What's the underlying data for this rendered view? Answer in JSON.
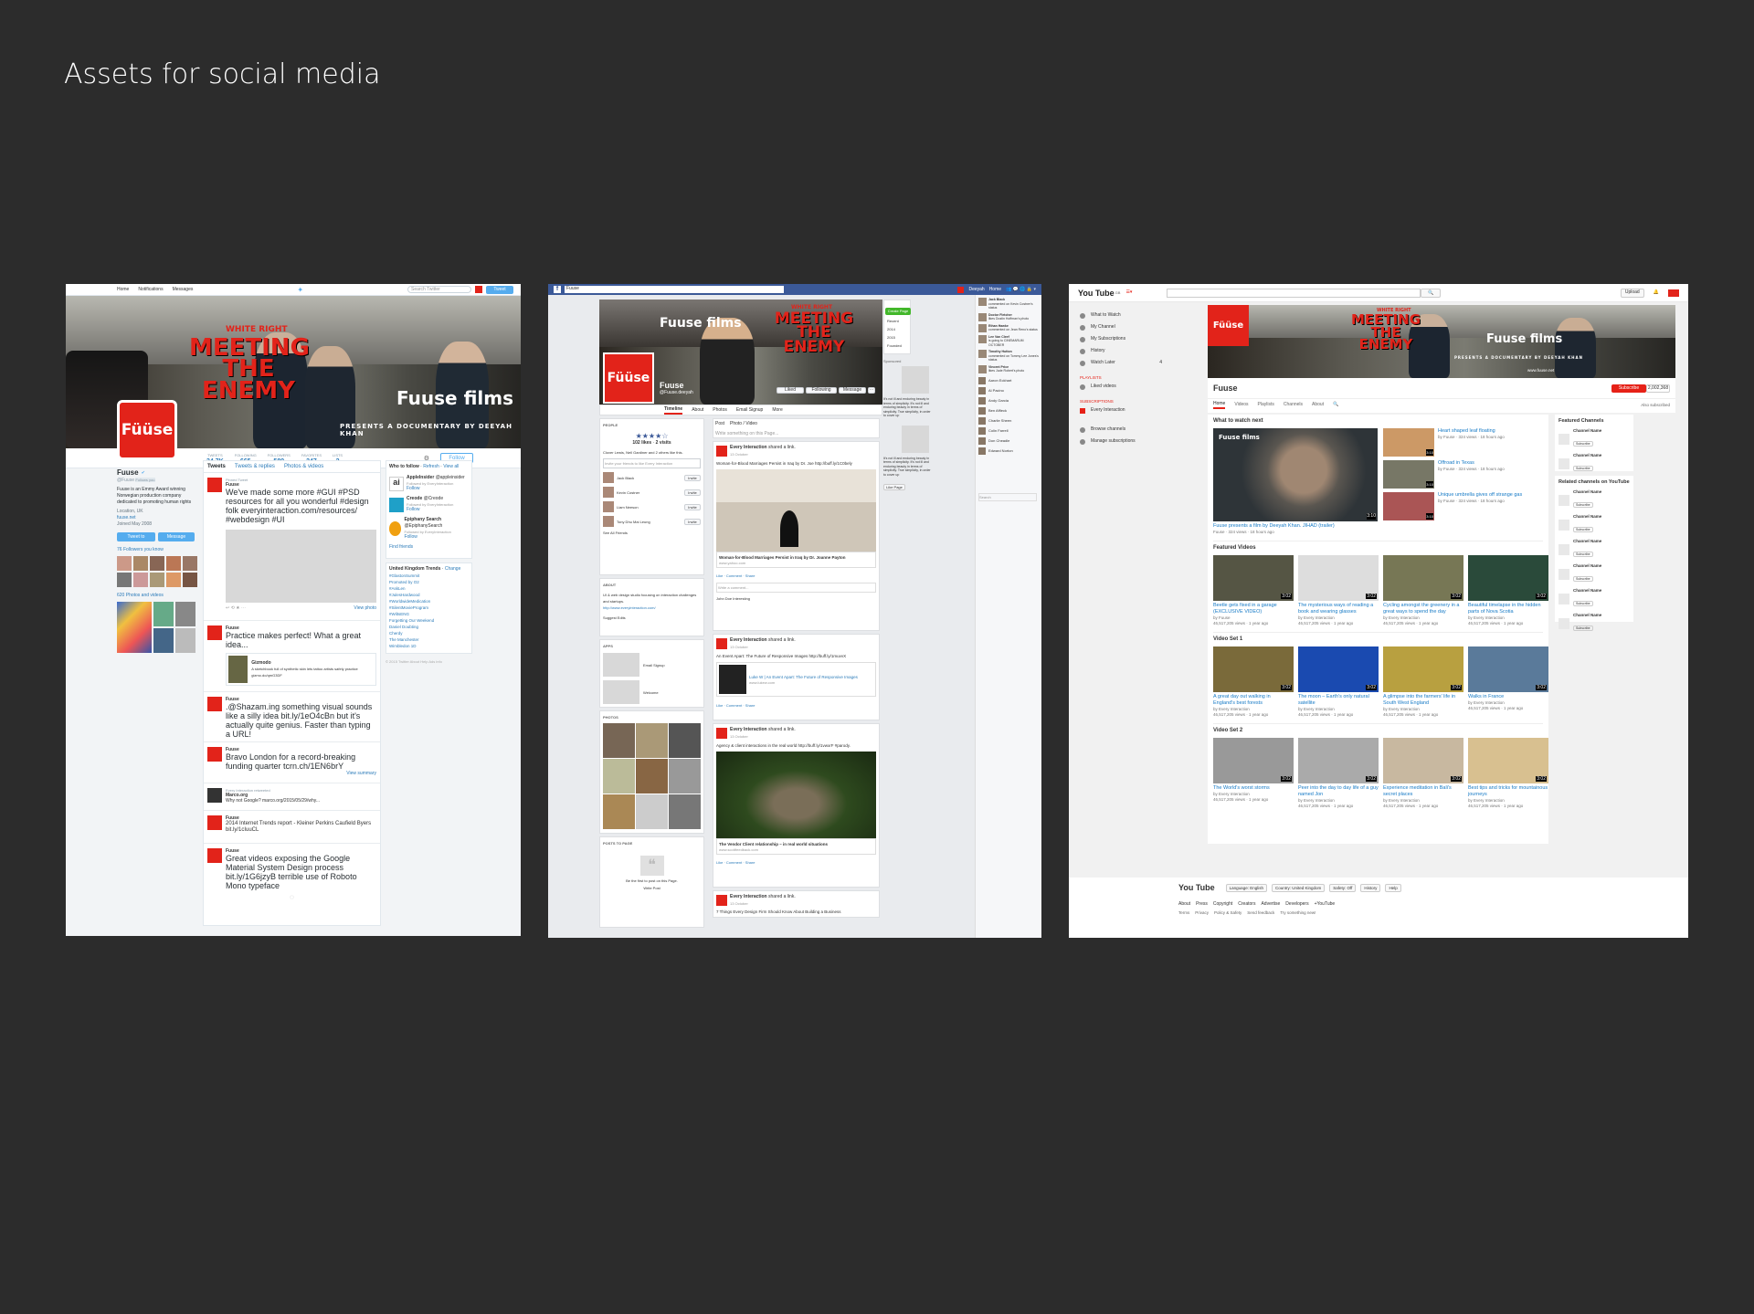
{
  "page": {
    "title": "Assets for social media"
  },
  "twitter": {
    "nav": [
      "Home",
      "Notifications",
      "Messages"
    ],
    "search_placeholder": "Search Twitter",
    "tweet_button": "Tweet",
    "banner": {
      "white_right": "WHITE RIGHT",
      "meeting": "MEETING",
      "the": "THE",
      "enemy": "ENEMY",
      "films": "Fuuse films",
      "present": "PRESENTS A DOCUMENTARY BY DEEYAH KHAN"
    },
    "profile": {
      "name": "Fuuse",
      "handle": "@Fuuse",
      "follows_you": "Follows you",
      "bio": "Fuuse is an Emmy Award winning Norwegian production company dedicated to promoting human rights",
      "location": "Location, UK",
      "url": "fuuse.net",
      "joined": "Joined May 2008",
      "logo": "Füüse"
    },
    "stats": [
      {
        "label": "TWEETS",
        "value": "34.7K"
      },
      {
        "label": "FOLLOWING",
        "value": "665"
      },
      {
        "label": "FOLLOWERS",
        "value": "589"
      },
      {
        "label": "FAVORITES",
        "value": "247"
      },
      {
        "label": "LISTS",
        "value": "2"
      }
    ],
    "follow_label": "Follow",
    "tabs": [
      "Tweets",
      "Tweets & replies",
      "Photos & videos"
    ],
    "tweet_to": "Tweet to",
    "message": "Message",
    "followers_you_know": "76 Followers you know",
    "photos_videos": "620 Photos and videos",
    "view_photo": "View photo",
    "view_summary": "View summary",
    "tweets": [
      {
        "meta": "Pinned Tweet",
        "name": "Fuuse",
        "text": "We've made some more #GUI #PSD resources for all you wonderful #design folk everyinteraction.com/resources/ #webdesign #UI"
      },
      {
        "name": "Fuuse",
        "text": "Practice makes perfect! What a great idea...",
        "quote_name": "Gizmodo",
        "quote": "A sketchbook full of synthetic skin lets tattoo artists safely practice gizmo.do/qmG3DF"
      },
      {
        "name": "Fuuse",
        "text": ".@Shazam.ing something visual sounds like a silly idea bit.ly/1eO4cBn but it's actually quite genius. Faster than typing a URL!"
      },
      {
        "name": "Fuuse",
        "text": "Bravo London for a record-breaking funding quarter tcrn.ch/1EN6brY"
      },
      {
        "meta": "Every Interaction retweeted",
        "name": "Marco.org",
        "text": "Why not Google? marco.org/2015/05/29/why..."
      },
      {
        "name": "Fuuse",
        "text": "2014 Internet Trends report - Kleiner Perkins Caufield Byers bit.ly/1cIuuCL"
      },
      {
        "name": "Fuuse",
        "text": "Great videos exposing the Google Material System Design process bit.ly/1G6jzyB terrible use of Roboto Mono typeface"
      }
    ],
    "who_to_follow": "Who to follow",
    "refresh": "Refresh",
    "view_all": "View all",
    "suggestions": [
      {
        "name": "AppleInsider",
        "handle": "@appleinsider",
        "sub": "Followed by EveryInteraction"
      },
      {
        "name": "Creode",
        "handle": "@Creode",
        "sub": "Followed by EveryInteraction"
      },
      {
        "name": "Epiphany Search",
        "handle": "@EpiphanySearch",
        "sub": "Followed by EveryInteraction"
      }
    ],
    "find_friends": "Find friends",
    "trends_title": "United Kingdom Trends",
    "change": "Change",
    "trends": [
      "#GlastonSummit",
      "Promoted by O2",
      "#AskLen",
      "#JulesHardwood",
      "#WorldwideMedication",
      "#SilentMovieProgram",
      "#WiltsENG",
      "Forgetting Our Weekend",
      "Daniel Doubting",
      "Cherdy",
      "The Manchester",
      "Wimbledon 1D"
    ],
    "footer": "© 2015 Twitter  About  Help  Ads info"
  },
  "facebook": {
    "search": "Fuuse",
    "nav_user": "Deeyah",
    "nav_home": "Home",
    "page_name": "Fuuse",
    "page_handle": "@Fuuse.deeyah",
    "liked": "Liked",
    "following": "Following",
    "message": "Message",
    "create_page": "Create Page",
    "years": [
      "Recent",
      "2014",
      "2015",
      "Founded"
    ],
    "sponsored": "Sponsored",
    "tabs": [
      "Timeline",
      "About",
      "Photos",
      "Email Signup",
      "More"
    ],
    "people": "PEOPLE",
    "likes_count": "102 likes",
    "visits": "2 visits",
    "friends_like": "Clover Lewis, Neil Gardiner and 2 others like this.",
    "invite_placeholder": "Invite your friends to like Every Interaction",
    "invite": "Invite",
    "invite_people": [
      "Jack Black",
      "Kevin Costner",
      "Liam Neeson",
      "Tony Dhu Mai Leung"
    ],
    "see_all_friends": "See All Friends",
    "about": "ABOUT",
    "about_text": "UI & web design studio focusing on interaction challenges and startups.",
    "about_url": "http://www.everyinteraction.com/",
    "suggest_edits": "Suggest Edits",
    "apps": "APPS",
    "apps_list": [
      "Email Signup",
      "Welcome"
    ],
    "photos": "PHOTOS",
    "posts_to_page": "POSTS TO PAGE",
    "first_to_post": "Be the first to post on this Page.",
    "write_post": "Write Post",
    "composer": [
      "Post",
      "Photo / Video"
    ],
    "composer_placeholder": "Write something on this Page...",
    "posts": [
      {
        "name": "Every Interaction",
        "meta": "shared a link.",
        "date": "13 October",
        "text": "Woman-for-Blood Marriages Persist in Iraq by Dr. Joe http://buff.ly/1C0bely",
        "link_title": "Woman-for-Blood Marriages Persist in Iraq by Dr. Joanne Payton",
        "link_domain": "www.yahoo.com"
      },
      {
        "name": "Every Interaction",
        "meta": "shared a link.",
        "date": "13 October",
        "text": "An Event Apart: The Future of Responsive Images http://buff.ly/1muvvX",
        "link_title": "Luke W | An Event Apart: The Future of Responsive Images",
        "link_domain": "www.lukew.com"
      },
      {
        "name": "Every Interaction",
        "meta": "shared a link.",
        "date": "13 October",
        "text": "Agency & client interactions in the real world http://buff.ly/1vwxrF #parody.",
        "link_title": "The Vendor Client relationship – in real world situations",
        "link_domain": "www.scottfeedback.com"
      },
      {
        "name": "Every Interaction",
        "meta": "shared a link.",
        "date": "13 October",
        "text": "7 Things Every Design Firm Should Know About Building a Business"
      }
    ],
    "actions": "Like · Comment · Share",
    "comment_placeholder": "Write a comment...",
    "commenter": "John Doe Interesting",
    "sponsored_text": "It's not ill and enduring beauty in terms of simplicity. It's not ill and enduring beauty in terms of simplicity. True simplicity, in order to cover up",
    "like_page": "Like Page",
    "chat": [
      {
        "name": "Jack Black",
        "text": "commented on Kevin Costner's status"
      },
      {
        "name": "Doctor Fletcher",
        "text": "likes Dustin Hoffman's photo"
      },
      {
        "name": "Ethan Hawke",
        "text": "commented on Jean Reno's status"
      },
      {
        "name": "Lee Van Cleef",
        "text": "is going to CINEMARUM OCTOBER"
      },
      {
        "name": "Timothy Hutton",
        "text": "commented on Tommy Lee Jones's status"
      },
      {
        "name": "Vincent Price",
        "text": "likes Jude Robert's photo"
      }
    ],
    "contacts": [
      "Aaron Eckhart",
      "Al Pacino",
      "Andy Garcia",
      "Ben Affleck",
      "Charlie Sheen",
      "Colin Farrell",
      "Don Cheadle",
      "Edward Norton"
    ],
    "chat_search": "Search"
  },
  "youtube": {
    "logo": "You Tube",
    "logo_region": "GB",
    "upload": "Upload",
    "sidebar": [
      "What to Watch",
      "My Channel",
      "My Subscriptions",
      "History",
      "Watch Later"
    ],
    "watch_later_count": "4",
    "playlists": "PLAYLISTS",
    "liked_videos": "Liked videos",
    "subscriptions": "SUBSCRIPTIONS",
    "sub_item": "Every Interaction",
    "browse": "Browse channels",
    "manage": "Manage subscriptions",
    "channel_name": "Fuuse",
    "subscribe": "Subscribe",
    "sub_count": "2,002,368",
    "also_subscribed": "Also subscribed",
    "tabs": [
      "Home",
      "Videos",
      "Playlists",
      "Channels",
      "About"
    ],
    "url": "www.fuuse.net",
    "what_to_watch": "What to watch next",
    "featured": {
      "title": "Fuuse presents a film by Deeyah Khan. JIHAD (trailer)",
      "meta": "Fuuse · 324 views · 18 hours ago",
      "dur": "3:10"
    },
    "side_videos": [
      {
        "title": "Heart shaped leaf floating",
        "meta": "by Fuuse · 324 views · 18 hours ago",
        "dur": "3:10"
      },
      {
        "title": "Offroad in Texas",
        "meta": "by Fuuse · 324 views · 18 hours ago",
        "dur": "3:10"
      },
      {
        "title": "Unique umbrella gives off strange gas",
        "meta": "by Fuuse · 324 views · 18 hours ago",
        "dur": "3:10"
      }
    ],
    "sections": [
      {
        "title": "Featured Videos",
        "videos": [
          {
            "title": "Beetle gets fixed in a garage (EXCLUSIVE VIDEO)",
            "by": "by Fuuse",
            "meta": "46,517,205 views · 1 year ago",
            "dur": "3:02"
          },
          {
            "title": "The mysterious ways of reading a book and wearing glasses",
            "by": "by Every Interaction",
            "meta": "46,517,205 views · 1 year ago",
            "dur": "3:02"
          },
          {
            "title": "Cycling amongst the greenery in a great ways to spend the day",
            "by": "by Every Interaction",
            "meta": "46,517,205 views · 1 year ago",
            "dur": "3:02"
          },
          {
            "title": "Beautiful timelapse in the hidden parts of Nova Scotia",
            "by": "by Every Interaction",
            "meta": "46,517,205 views · 1 year ago",
            "dur": "3:02"
          }
        ]
      },
      {
        "title": "Video Set 1",
        "videos": [
          {
            "title": "A great day out walking in England's best forests",
            "by": "by Every Interaction",
            "meta": "46,517,205 views · 1 year ago",
            "dur": "3:02"
          },
          {
            "title": "The moon – Earth's only natural satellite",
            "by": "by Every Interaction",
            "meta": "46,517,205 views · 1 year ago",
            "dur": "3:02"
          },
          {
            "title": "A glimpse into the farmers' life in South West England",
            "by": "by Every Interaction",
            "meta": "46,517,205 views · 1 year ago",
            "dur": "3:02"
          },
          {
            "title": "Walks in France",
            "by": "by Every Interaction",
            "meta": "46,517,205 views · 1 year ago",
            "dur": "3:02"
          }
        ]
      },
      {
        "title": "Video Set 2",
        "videos": [
          {
            "title": "The World's worst storms",
            "by": "by Every Interaction",
            "meta": "46,517,205 views · 1 year ago",
            "dur": "3:02"
          },
          {
            "title": "Peer into the day to day life of a guy named Jon",
            "by": "by Every Interaction",
            "meta": "46,517,205 views · 1 year ago",
            "dur": "3:02"
          },
          {
            "title": "Experience meditation in Bali's secret places",
            "by": "by Every Interaction",
            "meta": "46,517,205 views · 1 year ago",
            "dur": "3:02"
          },
          {
            "title": "Best tips and tricks for mountainous journeys",
            "by": "by Every Interaction",
            "meta": "46,517,205 views · 1 year ago",
            "dur": "3:02"
          }
        ]
      }
    ],
    "featured_channels": "Featured Channels",
    "related_channels": "Related channels on YouTube",
    "channel_label": "Channel Name",
    "footer_buttons": [
      "Language: English",
      "Country: United Kingdom",
      "Safety: Off",
      "History",
      "Help"
    ],
    "footer_links1": [
      "About",
      "Press",
      "Copyright",
      "Creators",
      "Advertise",
      "Developers",
      "+YouTube"
    ],
    "footer_links2": [
      "Terms",
      "Privacy",
      "Policy & Safety",
      "Send feedback",
      "Try something new!"
    ]
  },
  "colors": {
    "bg": "#2c2c2c",
    "brand_red": "#e2231a",
    "twitter_blue": "#55acee",
    "facebook_blue": "#3b5998",
    "youtube_red": "#e62117"
  }
}
